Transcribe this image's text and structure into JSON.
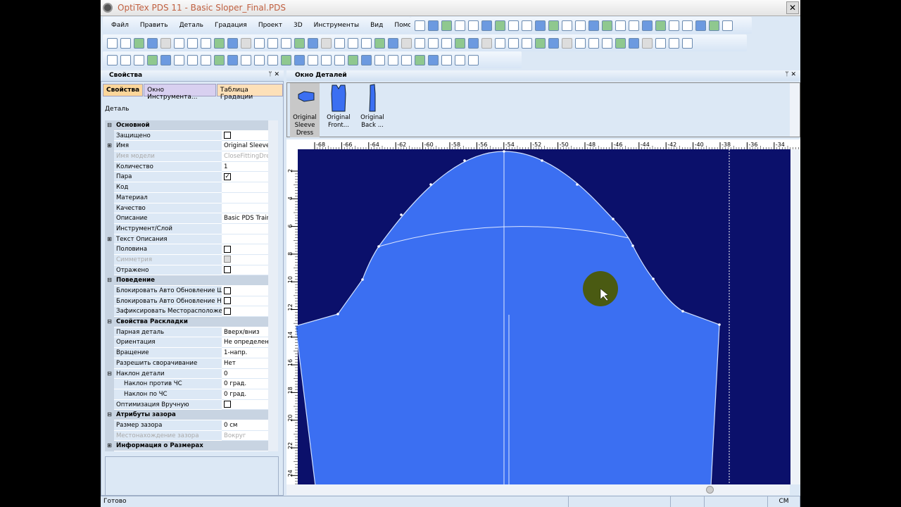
{
  "window": {
    "title": "OptiTex PDS 11 - Basic Sloper_Final.PDS",
    "close": "✕"
  },
  "menu": [
    "Файл",
    "Править",
    "Деталь",
    "Градация",
    "Проект",
    "3D",
    "Инструменты",
    "Вид",
    "Помощь"
  ],
  "left_panel": {
    "title": "Свойства",
    "pin": "ᛘ ✕",
    "tabs": [
      "Свойства",
      "Окно Инструмента...",
      "Таблица Градации"
    ],
    "object": "Деталь",
    "rows": [
      {
        "type": "cat",
        "name": "Основной",
        "exp": "⊟"
      },
      {
        "name": "Защищено",
        "cb": ""
      },
      {
        "name": "Имя",
        "value": "Original Sleeve",
        "exp": "⊞"
      },
      {
        "name": "Имя модели",
        "value": "CloseFittingDre",
        "dis": true
      },
      {
        "name": "Количество",
        "value": "1"
      },
      {
        "name": "Пара",
        "cb": "✓"
      },
      {
        "name": "Код",
        "value": ""
      },
      {
        "name": "Материал",
        "value": ""
      },
      {
        "name": "Качество",
        "value": ""
      },
      {
        "name": "Описание",
        "value": "Basic PDS Trair"
      },
      {
        "name": "Инструмент/Слой",
        "value": ""
      },
      {
        "name": "Текст Описания",
        "value": "",
        "exp": "⊞"
      },
      {
        "name": "Половина",
        "cb": ""
      },
      {
        "name": "Симметрия",
        "cb": "",
        "dis": true
      },
      {
        "name": "Отражено",
        "cb": ""
      },
      {
        "type": "cat",
        "name": "Поведение",
        "exp": "⊟"
      },
      {
        "name": "Блокировать Авто Обновление Шв",
        "cb": ""
      },
      {
        "name": "Блокировать Авто Обновление На",
        "cb": ""
      },
      {
        "name": "Зафиксировать Месторасположен",
        "cb": ""
      },
      {
        "type": "cat",
        "name": "Свойства Раскладки",
        "exp": "⊟"
      },
      {
        "name": "Парная деталь",
        "value": "Вверх/вниз"
      },
      {
        "name": "Ориентация",
        "value": "Не определен"
      },
      {
        "name": "Вращение",
        "value": "1-напр."
      },
      {
        "name": "Разрешить сворачивание",
        "value": "Нет"
      },
      {
        "name": "Наклон детали",
        "value": "0",
        "exp": "⊟"
      },
      {
        "name": "Наклон против ЧС",
        "value": "0 град.",
        "ind": true
      },
      {
        "name": "Наклон по ЧС",
        "value": "0 град.",
        "ind": true
      },
      {
        "name": "Оптимизация Вручную",
        "cb": ""
      },
      {
        "type": "cat",
        "name": "Атрибуты зазора",
        "exp": "⊟"
      },
      {
        "name": "Размер зазора",
        "value": "0 см"
      },
      {
        "name": "Местонахождение зазора",
        "value": "Вокруг",
        "dis": true
      },
      {
        "type": "cat",
        "name": "Информация о Размерах",
        "exp": "⊞"
      }
    ]
  },
  "details_window": {
    "title": "Окно Деталей",
    "pin": "ᛘ ✕",
    "thumbs": [
      {
        "l1": "Original",
        "l2": "Sleeve",
        "l3": "Dress"
      },
      {
        "l1": "Original",
        "l2": "Front..."
      },
      {
        "l1": "Original",
        "l2": "Back ..."
      }
    ]
  },
  "ruler": {
    "x": [
      "-68",
      "-66",
      "-64",
      "-62",
      "-60",
      "-58",
      "-56",
      "-54",
      "-52",
      "-50",
      "-48",
      "-46",
      "-44",
      "-42",
      "-40",
      "-38",
      "-36",
      "-34"
    ],
    "y": [
      "2",
      "4",
      "6",
      "8",
      "10",
      "12",
      "14",
      "16",
      "18",
      "20",
      "22",
      "24"
    ]
  },
  "colors": {
    "canvas": "#0b106b",
    "piece": "#3b6ff2",
    "cursor": "#4a5a12"
  },
  "status": {
    "text": "Готово",
    "unit": "СМ"
  }
}
